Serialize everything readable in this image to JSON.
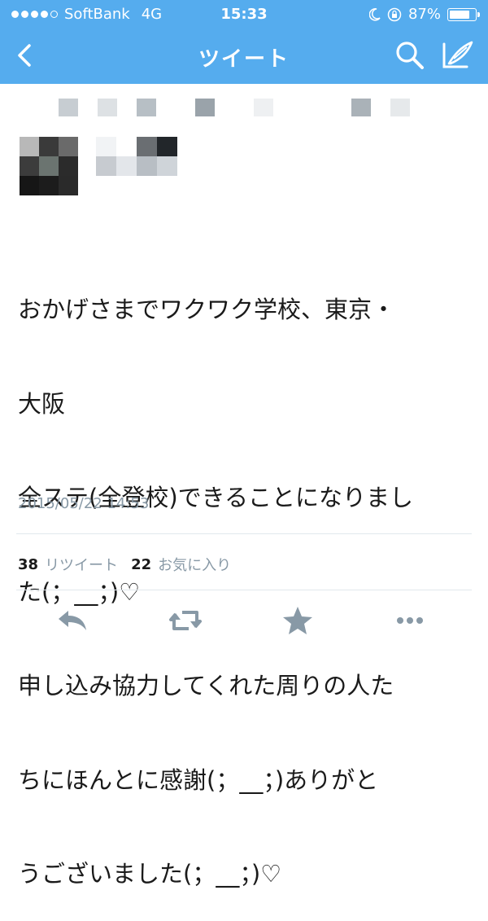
{
  "status_bar": {
    "carrier": "SoftBank",
    "network": "4G",
    "time": "15:33",
    "battery": "87%",
    "battery_level": 0.87
  },
  "nav": {
    "title": "ツイート"
  },
  "tweet": {
    "lines": [
      "おかげさまでワクワク学校、東京・",
      "大阪",
      "全ステ(全登校)できることになりまし",
      "た(；__；)♡",
      "申し込み協力してくれた周りの人た",
      "ちにほんとに感謝(；__；)ありがと",
      "うございました(；__；)♡"
    ],
    "timestamp": "2015/05/22 14:53"
  },
  "stats": {
    "retweet_count": "38",
    "retweet_label": "リツイート",
    "favorite_count": "22",
    "favorite_label": "お気に入り"
  },
  "icons": {
    "back": "chevron-left-icon",
    "search": "search-icon",
    "compose": "compose-icon",
    "reply": "reply-icon",
    "retweet": "retweet-icon",
    "favorite": "star-icon",
    "more": "more-icon"
  },
  "colors": {
    "accent": "#55acee",
    "muted": "#8899a6",
    "action_icons": "#8899a6"
  }
}
